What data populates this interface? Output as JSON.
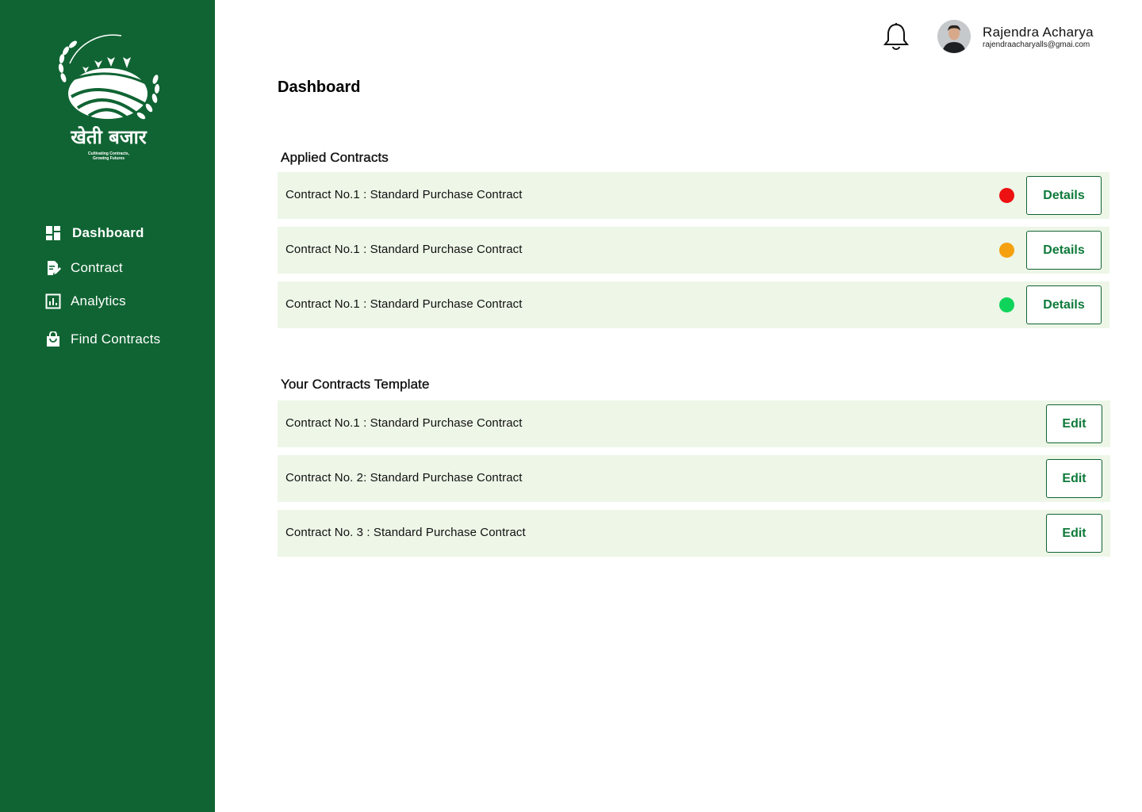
{
  "brand": {
    "name": "खेती बजार",
    "tagline_line1": "Cultivating Contracts,",
    "tagline_line2": "Growing Futures"
  },
  "sidebar": {
    "items": [
      {
        "label": "Dashboard",
        "icon": "dashboard-icon",
        "active": true
      },
      {
        "label": "Contract",
        "icon": "contract-edit-icon",
        "active": false
      },
      {
        "label": "Analytics",
        "icon": "analytics-icon",
        "active": false
      },
      {
        "label": "Find Contracts",
        "icon": "shopping-bag-icon",
        "active": false
      }
    ]
  },
  "header": {
    "bell_icon": "bell-icon",
    "user": {
      "name": "Rajendra Acharya",
      "email": "rajendraacharyalls@gmai.com"
    }
  },
  "main": {
    "title": "Dashboard",
    "applied": {
      "title": "Applied Contracts",
      "rows": [
        {
          "label": "Contract No.1 : Standard Purchase Contract",
          "status_color": "#ee1111",
          "action": "Details"
        },
        {
          "label": "Contract No.1 : Standard Purchase Contract",
          "status_color": "#f5a00f",
          "action": "Details"
        },
        {
          "label": "Contract No.1 : Standard Purchase Contract",
          "status_color": "#0fd45a",
          "action": "Details"
        }
      ]
    },
    "templates": {
      "title": "Your Contracts Template",
      "rows": [
        {
          "label": "Contract No.1 : Standard Purchase Contract",
          "action": "Edit"
        },
        {
          "label": "Contract No. 2: Standard Purchase Contract",
          "action": "Edit"
        },
        {
          "label": "Contract No. 3 : Standard Purchase Contract",
          "action": "Edit"
        }
      ]
    }
  },
  "colors": {
    "sidebar_bg": "#106433",
    "row_bg": "#edf6e7",
    "accent": "#0e7a3a"
  }
}
